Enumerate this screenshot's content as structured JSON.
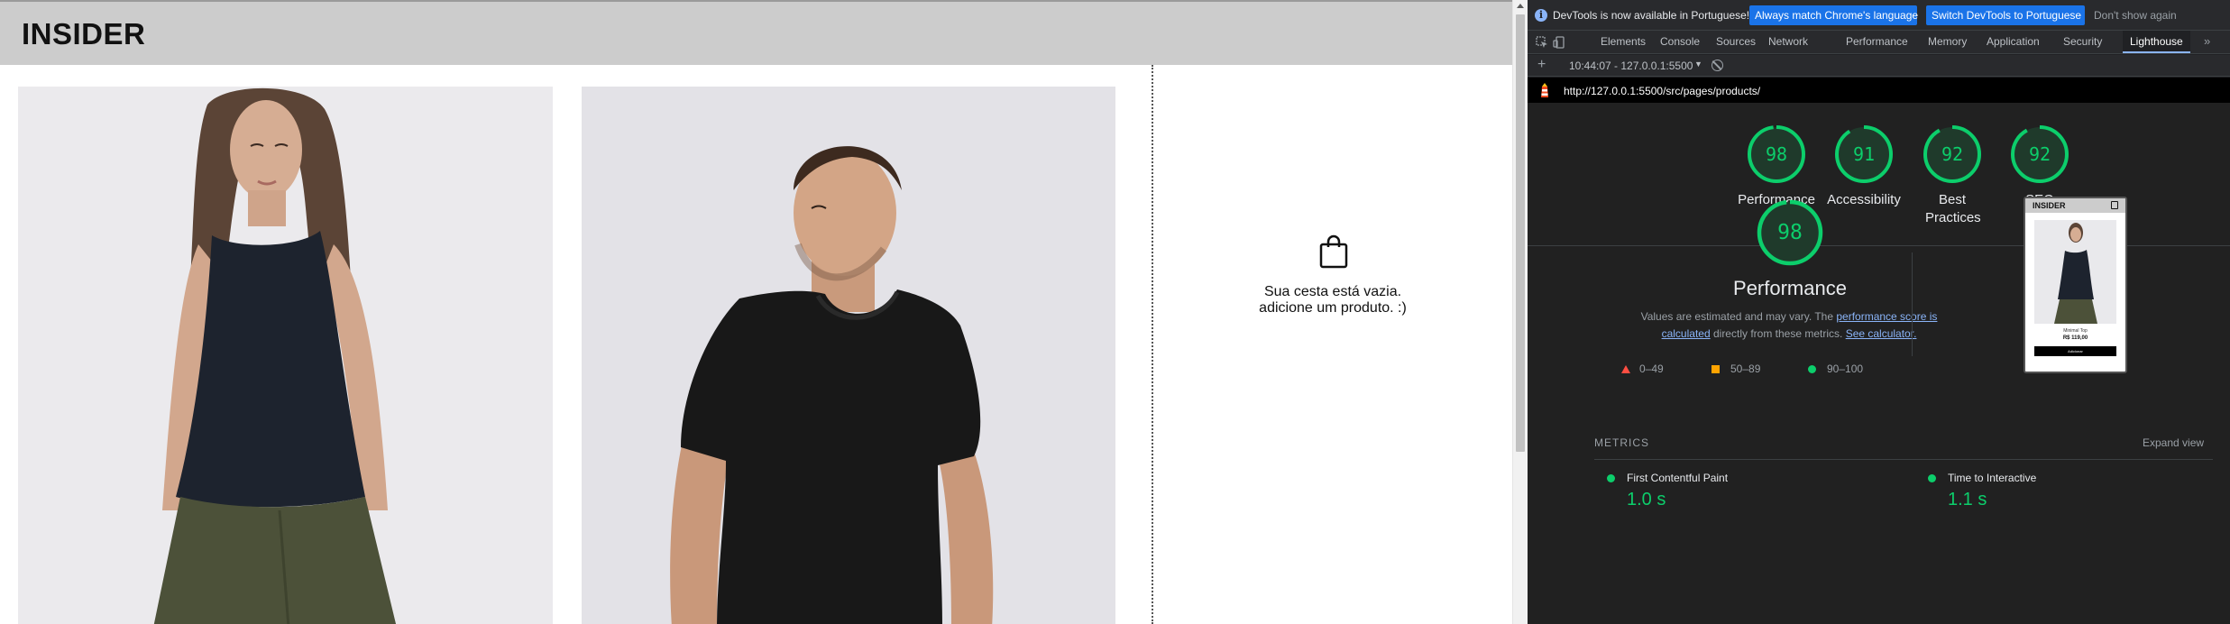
{
  "site": {
    "logo": "INSIDER",
    "cart_empty_line1": "Sua cesta está vazia.",
    "cart_empty_line2": "adicione um produto. :)"
  },
  "devtools": {
    "infobar": {
      "message": "DevTools is now available in Portuguese!",
      "match_button": "Always match Chrome's language",
      "switch_button": "Switch DevTools to Portuguese",
      "dismiss": "Don't show again"
    },
    "tabs": [
      {
        "label": "Elements"
      },
      {
        "label": "Console"
      },
      {
        "label": "Sources"
      },
      {
        "label": "Network"
      },
      {
        "label": "Performance"
      },
      {
        "label": "Memory"
      },
      {
        "label": "Application"
      },
      {
        "label": "Security"
      },
      {
        "label": "Lighthouse"
      }
    ],
    "active_tab": "Lighthouse",
    "more_tabs": "»"
  },
  "lighthouse": {
    "report_select": "10:44:07 - 127.0.0.1:5500",
    "url": "http://127.0.0.1:5500/src/pages/products/",
    "scores": [
      {
        "label": "Performance",
        "value": 98
      },
      {
        "label": "Accessibility",
        "value": 91
      },
      {
        "label": "Best Practices",
        "value": 92
      },
      {
        "label": "SEO",
        "value": 92
      }
    ],
    "perf_title": "Performance",
    "perf_score": 98,
    "desc_prefix": "Values are estimated and may vary. The ",
    "desc_link1": "performance score is calculated",
    "desc_mid": " directly from these metrics. ",
    "desc_link2": "See calculator.",
    "legend": {
      "poor": "0–49",
      "average": "50–89",
      "good": "90–100"
    },
    "thumbnail": {
      "logo": "INSIDER",
      "product_name": "Minimal Top",
      "price": "R$ 119,00",
      "button": "Adicionar"
    },
    "metrics_title": "METRICS",
    "expand_view": "Expand view",
    "metrics": [
      {
        "name": "First Contentful Paint",
        "value": "1.0 s"
      },
      {
        "name": "Time to Interactive",
        "value": "1.1 s"
      }
    ],
    "colors": {
      "good": "#0cce6b",
      "average": "#ffa400",
      "poor": "#ff4e42"
    }
  }
}
